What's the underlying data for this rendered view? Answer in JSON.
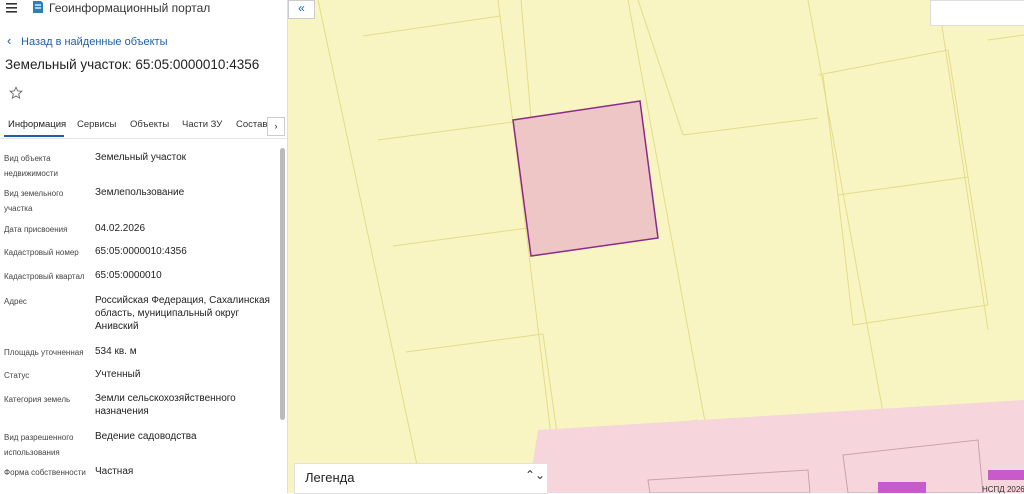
{
  "app": {
    "title": "Геоинформационный портал"
  },
  "nav": {
    "back_label": "Назад в найденные объекты"
  },
  "object": {
    "title": "Земельный участок: 65:05:0000010:4356"
  },
  "tabs": [
    {
      "label": "Информация",
      "active": true
    },
    {
      "label": "Сервисы"
    },
    {
      "label": "Объекты"
    },
    {
      "label": "Части ЗУ"
    },
    {
      "label": "Состав"
    }
  ],
  "tabs_next": "›",
  "properties": [
    {
      "label": "Вид объекта недвижимости",
      "value": "Земельный участок"
    },
    {
      "label": "Вид земельного участка",
      "value": "Землепользование"
    },
    {
      "label": "Дата присвоения",
      "value": "04.02.2026"
    },
    {
      "label": "Кадастровый номер",
      "value": "65:05:0000010:4356"
    },
    {
      "label": "Кадастровый квартал",
      "value": "65:05:0000010"
    },
    {
      "label": "Адрес",
      "value": "Российская Федерация, Сахалинская область, муниципальный округ Анивский"
    },
    {
      "label": "Площадь уточненная",
      "value": "534 кв. м"
    },
    {
      "label": "Статус",
      "value": "Учтенный"
    },
    {
      "label": "Категория земель",
      "value": "Земли сельскохозяйственного назначения"
    },
    {
      "label": "Вид разрешенного использования",
      "value": "Ведение садоводства"
    },
    {
      "label": "Форма собственности",
      "value": "Частная"
    }
  ],
  "map": {
    "collapse_label": "«",
    "legend_label": "Легенда",
    "legend_chevron": "⌃⌄",
    "copyright": "НСПД 2026",
    "colors": {
      "parcel_fill": "#f8f5c2",
      "parcel_stroke": "#e3dc8a",
      "highlight_fill": "#eec6c6",
      "highlight_stroke": "#8b2a8b",
      "urban_fill": "#f6d6dc"
    }
  }
}
